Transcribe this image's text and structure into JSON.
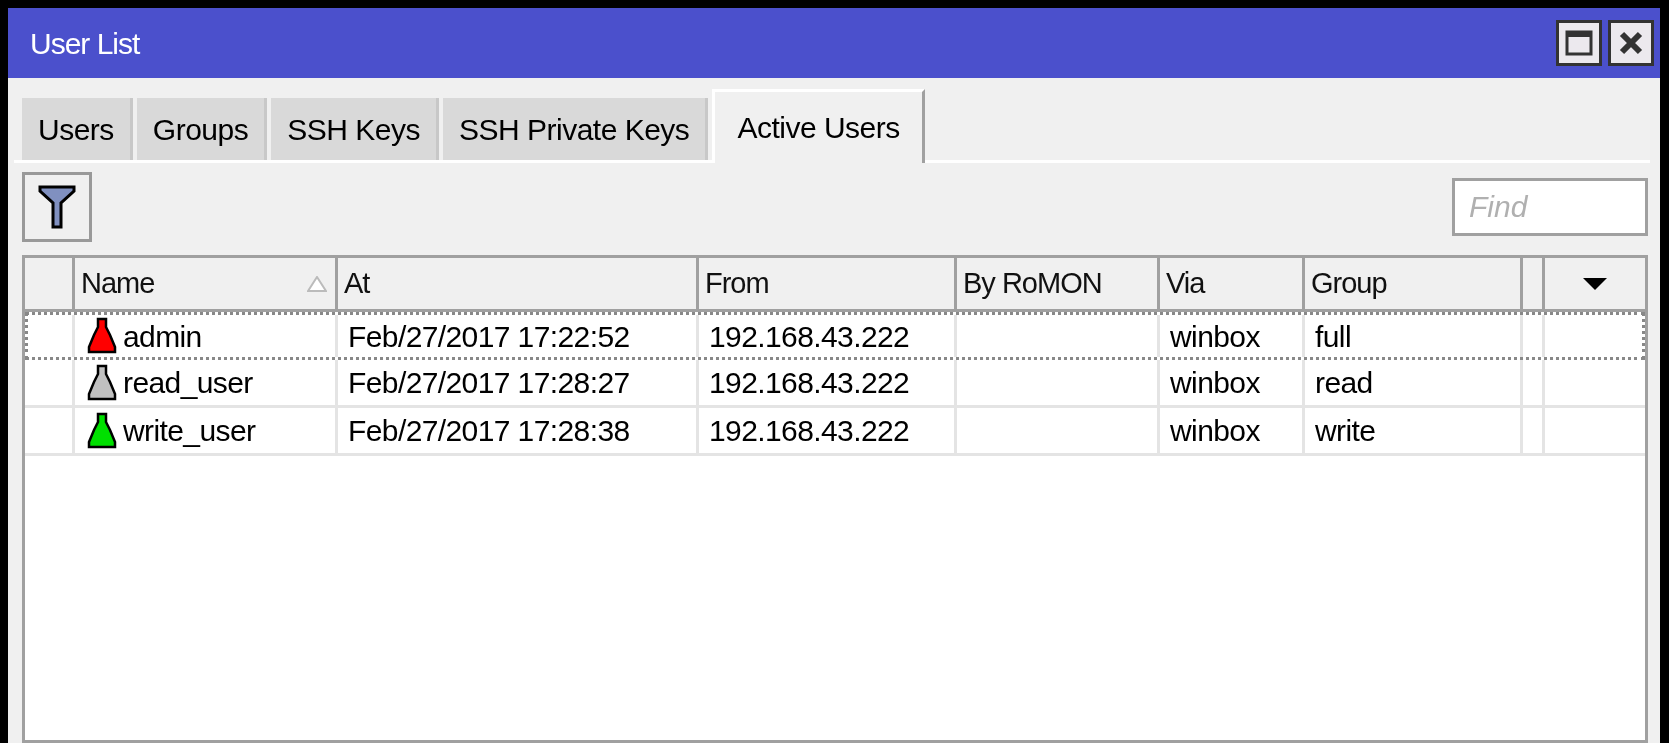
{
  "window": {
    "title": "User List"
  },
  "tabs": [
    {
      "label": "Users",
      "selected": false
    },
    {
      "label": "Groups",
      "selected": false
    },
    {
      "label": "SSH Keys",
      "selected": false
    },
    {
      "label": "SSH Private Keys",
      "selected": false
    },
    {
      "label": "Active Users",
      "selected": true
    }
  ],
  "search": {
    "placeholder": "Find"
  },
  "table": {
    "columns": [
      "Name",
      "At",
      "From",
      "By RoMON",
      "Via",
      "Group"
    ],
    "rows": [
      {
        "selected": true,
        "color": "#ff0000",
        "cells": [
          "admin",
          "Feb/27/2017 17:22:52",
          "192.168.43.222",
          "",
          "winbox",
          "full"
        ]
      },
      {
        "selected": false,
        "color": "#c0c0c0",
        "cells": [
          "read_user",
          "Feb/27/2017 17:28:27",
          "192.168.43.222",
          "",
          "winbox",
          "read"
        ]
      },
      {
        "selected": false,
        "color": "#00e000",
        "cells": [
          "write_user",
          "Feb/27/2017 17:28:38",
          "192.168.43.222",
          "",
          "winbox",
          "write"
        ]
      }
    ]
  }
}
